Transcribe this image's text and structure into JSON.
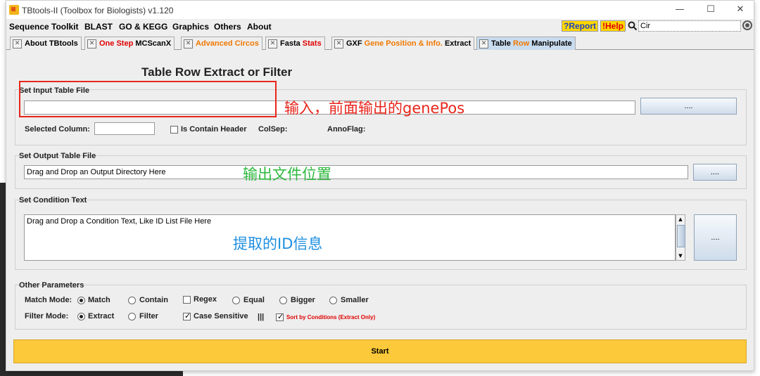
{
  "window": {
    "title": "TBtools-II (Toolbox for Biologists) v1.120"
  },
  "menu": [
    "Sequence Toolkit",
    "BLAST",
    "GO & KEGG",
    "Graphics",
    "Others",
    "About"
  ],
  "toolbar": {
    "report": "?Report",
    "help": "!Help",
    "search_value": "Cir"
  },
  "tabs": [
    {
      "label_parts": [
        {
          "t": "About TBtools",
          "c": ""
        }
      ]
    },
    {
      "label_parts": [
        {
          "t": "One Step ",
          "c": "red"
        },
        {
          "t": "MCScanX",
          "c": ""
        }
      ]
    },
    {
      "label_parts": [
        {
          "t": "Advanced Circos",
          "c": "orange"
        }
      ]
    },
    {
      "label_parts": [
        {
          "t": "Fasta ",
          "c": ""
        },
        {
          "t": "Stats",
          "c": "red"
        }
      ]
    },
    {
      "label_parts": [
        {
          "t": "GXF ",
          "c": ""
        },
        {
          "t": "Gene Position & Info.",
          "c": "orange"
        },
        {
          "t": " Extract",
          "c": ""
        }
      ]
    },
    {
      "label_parts": [
        {
          "t": "Table ",
          "c": ""
        },
        {
          "t": "Row",
          "c": "orange"
        },
        {
          "t": " Manipulate",
          "c": ""
        }
      ]
    }
  ],
  "heading": "Table Row Extract or Filter",
  "input_group": {
    "title": "Set Input Table File",
    "file_value": "",
    "browse_label": "....",
    "selected_column_label": "Selected Column:",
    "selected_column_value": "",
    "contain_header_label": "Is Contain Header",
    "colsep_label": "ColSep:",
    "annoflag_label": "AnnoFlag:"
  },
  "output_group": {
    "title": "Set Output Table File",
    "file_placeholder": "Drag and Drop an Output Directory Here",
    "browse_label": "...."
  },
  "condition_group": {
    "title": "Set Condition Text",
    "text_placeholder": "Drag and Drop a Condition Text, Like ID List File Here",
    "browse_label": "...."
  },
  "params": {
    "title": "Other Parameters",
    "match_mode_label": "Match Mode:",
    "match_options": [
      "Match",
      "Contain",
      "Regex",
      "Equal",
      "Bigger",
      "Smaller"
    ],
    "filter_mode_label": "Filter Mode:",
    "filter_options": [
      "Extract",
      "Filter"
    ],
    "case_sensitive_label": "Case Sensitive",
    "separator": "|||",
    "sort_label": "Sort by Conditions (Extract Only)"
  },
  "start_label": "Start",
  "annotations": {
    "input_note": "输入，前面输出的genePos",
    "output_note": "输出文件位置",
    "condition_note": "提取的ID信息"
  },
  "colors": {
    "annotation_red": "#e8261c",
    "annotation_green": "#2db83d",
    "annotation_blue": "#1e8fe0",
    "start_button": "#fbc93a"
  }
}
